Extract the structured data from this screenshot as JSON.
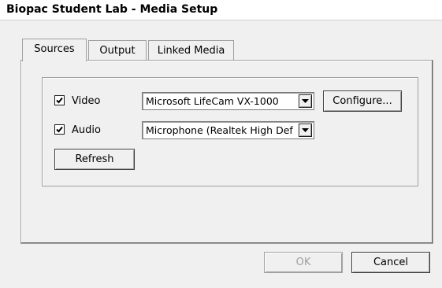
{
  "window": {
    "title": "Biopac Student Lab - Media Setup"
  },
  "tabs": [
    {
      "label": "Sources",
      "active": true
    },
    {
      "label": "Output",
      "active": false
    },
    {
      "label": "Linked Media",
      "active": false
    }
  ],
  "sources": {
    "video": {
      "label": "Video",
      "checked": true,
      "device": "Microsoft LifeCam VX-1000",
      "configure_label": "Configure..."
    },
    "audio": {
      "label": "Audio",
      "checked": true,
      "device": "Microphone (Realtek High Def"
    },
    "refresh_label": "Refresh"
  },
  "footer": {
    "ok_label": "OK",
    "ok_enabled": false,
    "cancel_label": "Cancel"
  },
  "icons": {
    "check": "check-icon",
    "dropdown": "chevron-down-icon"
  }
}
